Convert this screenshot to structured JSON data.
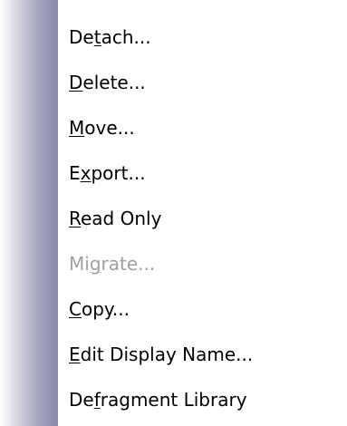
{
  "menu": {
    "items": [
      {
        "pre": "De",
        "mnemonic": "t",
        "post": "ach...",
        "disabled": false
      },
      {
        "pre": "",
        "mnemonic": "D",
        "post": "elete...",
        "disabled": false
      },
      {
        "pre": "",
        "mnemonic": "M",
        "post": "ove...",
        "disabled": false
      },
      {
        "pre": "E",
        "mnemonic": "x",
        "post": "port...",
        "disabled": false
      },
      {
        "pre": "",
        "mnemonic": "R",
        "post": "ead Only",
        "disabled": false
      },
      {
        "pre": "Mi",
        "mnemonic": "g",
        "post": "rate...",
        "disabled": true
      },
      {
        "pre": "",
        "mnemonic": "C",
        "post": "opy...",
        "disabled": false
      },
      {
        "pre": "",
        "mnemonic": "E",
        "post": "dit Display Name...",
        "disabled": false
      },
      {
        "pre": "De",
        "mnemonic": "f",
        "post": "ragment Library",
        "disabled": false
      }
    ],
    "colors": {
      "text": "#000000",
      "disabled_text": "#a0a0a0",
      "background": "#ffffff",
      "gutter": "#8a8aaa"
    }
  }
}
